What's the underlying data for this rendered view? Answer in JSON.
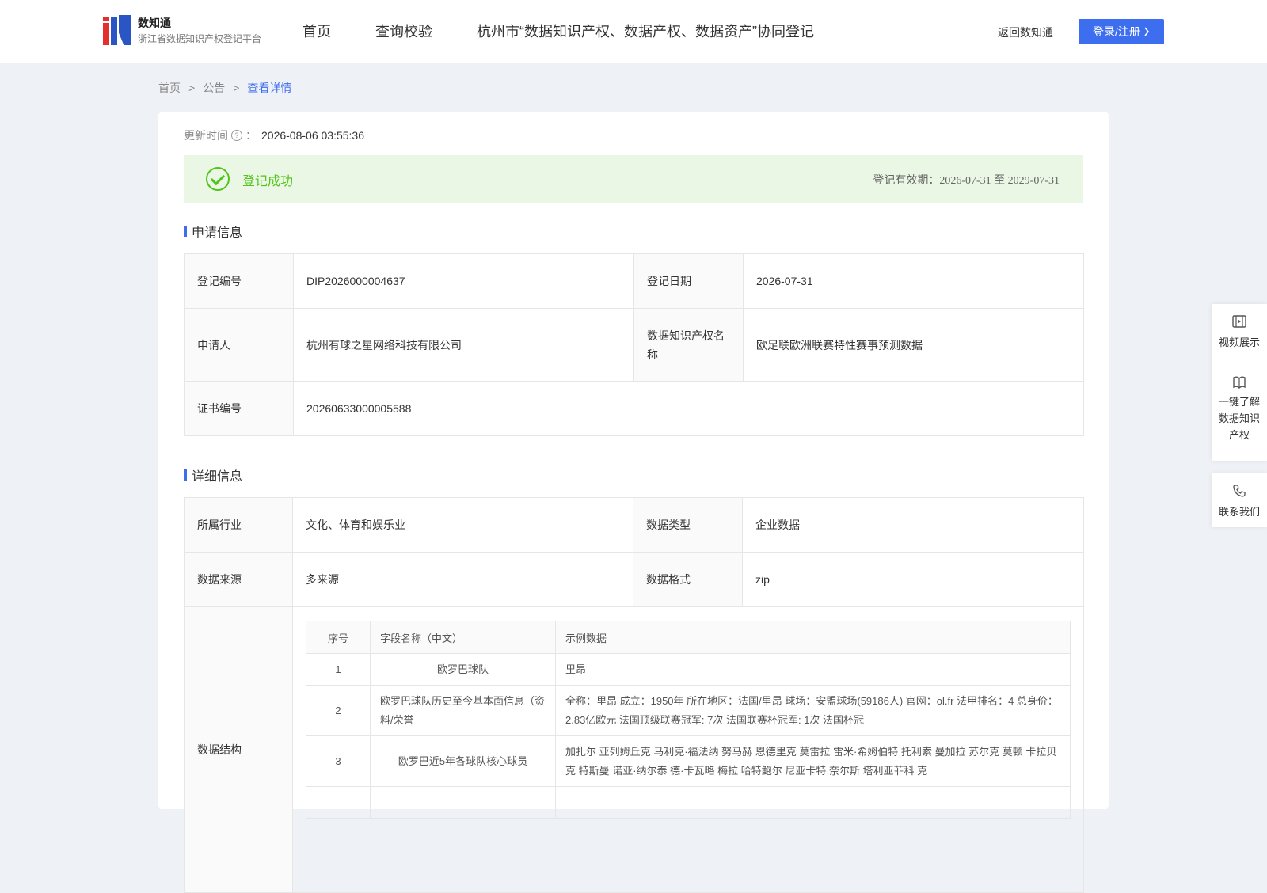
{
  "header": {
    "logo_name": "数知通",
    "logo_subtitle": "浙江省数据知识产权登记平台",
    "nav": [
      "首页",
      "查询校验",
      "杭州市“数据知识产权、数据产权、数据资产”协同登记"
    ],
    "back_label": "返回数知通",
    "login_label": "登录/注册"
  },
  "breadcrumb": {
    "home": "首页",
    "sep1": ">",
    "notice": "公告",
    "sep2": ">",
    "current": "查看详情"
  },
  "update": {
    "label": "更新时间",
    "colon": "：",
    "value": "2026-08-06 03:55:36"
  },
  "status": {
    "text": "登记成功",
    "validity": "登记有效期：2026-07-31 至 2029-07-31",
    "color": "#52c41a"
  },
  "apply_section": {
    "title": "申请信息",
    "reg_no_label": "登记编号",
    "reg_no": "DIP2026000004637",
    "reg_date_label": "登记日期",
    "reg_date": "2026-07-31",
    "applicant_label": "申请人",
    "applicant": "杭州有球之星网络科技有限公司",
    "ip_name_label": "数据知识产权名称",
    "ip_name": "欧足联欧洲联赛特性赛事预测数据",
    "cert_label": "证书编号",
    "cert_no": "20260633000005588"
  },
  "detail_section": {
    "title": "详细信息",
    "industry_label": "所属行业",
    "industry": "文化、体育和娱乐业",
    "data_type_label": "数据类型",
    "data_type": "企业数据",
    "source_label": "数据来源",
    "source": "多来源",
    "format_label": "数据格式",
    "format": "zip",
    "structure_label": "数据结构",
    "structure_headers": [
      "序号",
      "字段名称（中文）",
      "示例数据"
    ],
    "structure_rows": [
      {
        "no": "1",
        "field": "欧罗巴球队",
        "example": "里昂"
      },
      {
        "no": "2",
        "field": "欧罗巴球队历史至今基本面信息（资料/荣誉",
        "example": "全称：里昂 成立：1950年 所在地区：法国/里昂 球场：安盟球场(59186人) 官网：ol.fr 法甲排名：4 总身价：2.83亿欧元 法国顶级联赛冠军: 7次 法国联赛杯冠军: 1次 法国杯冠"
      },
      {
        "no": "3",
        "field": "欧罗巴近5年各球队核心球员",
        "example": "加扎尔 亚列姆丘克 马利克·福法纳 努马赫 恩德里克 莫雷拉 雷米·希姆伯特 托利索 曼加拉 苏尔克 莫顿 卡拉贝克 特斯曼 诺亚·纳尔泰 德·卡瓦略 梅拉 哈特鲍尔 尼亚卡特 奈尔斯 塔利亚菲科 克"
      }
    ]
  },
  "side_panel": {
    "video": "视频展示",
    "learn": "一键了解数据知识产权",
    "contact": "联系我们"
  },
  "colors": {
    "accent": "#3d6ef0",
    "success_bg": "#eaf7e4",
    "page_bg": "#eef1f5"
  }
}
